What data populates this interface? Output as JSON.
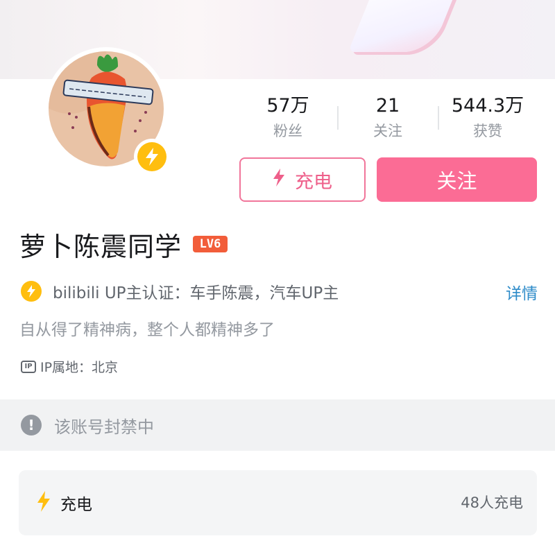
{
  "profile": {
    "name": "萝卜陈震同学",
    "level_badge": "LV6",
    "verification": "bilibili UP主认证：车手陈震，汽车UP主",
    "detail_link": "详情",
    "signature": "自从得了精神病，整个人都精神多了",
    "ip_location": "IP属地：北京",
    "ip_icon_text": "IP"
  },
  "stats": [
    {
      "value": "57万",
      "label": "粉丝"
    },
    {
      "value": "21",
      "label": "关注"
    },
    {
      "value": "544.3万",
      "label": "获赞"
    }
  ],
  "buttons": {
    "charge": "充电",
    "follow": "关注"
  },
  "banned_notice": "该账号封禁中",
  "charge_section": {
    "label": "充电",
    "count": "48人充电"
  },
  "colors": {
    "accent_pink": "#fb6c95",
    "charge_outline": "#f1759a",
    "lightning_yellow": "#ffbe0f",
    "level_badge": "#f25d3a",
    "link_blue": "#2d8bc9"
  },
  "icons": [
    "lightning-icon",
    "verified-lightning-icon",
    "ip-icon",
    "warning-icon",
    "avatar-carrot-tattoo"
  ]
}
